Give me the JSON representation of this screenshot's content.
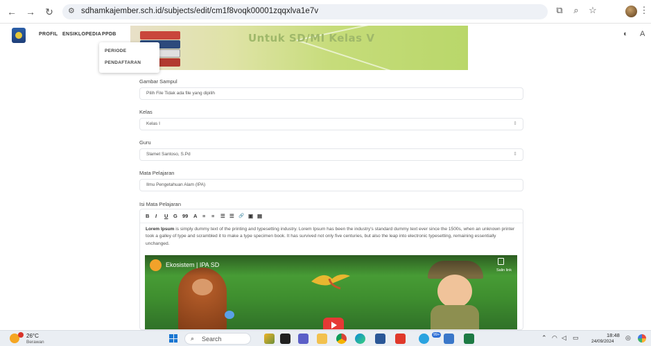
{
  "browser": {
    "url": "sdhamkajember.sch.id/subjects/edit/cm1f8voqk00001zqqxlva1e7v"
  },
  "site": {
    "menu": [
      "PROFIL",
      "ENSIKLOPEDIA",
      "PPDB"
    ],
    "dropdown": [
      "PERIODE",
      "PENDAFTARAN"
    ],
    "banner_text": "Untuk SD/MI Kelas V"
  },
  "form": {
    "gambar_label": "Gambar Sampul",
    "gambar_value": "Pilih File  Tidak ada file yang dipilih",
    "kelas_label": "Kelas",
    "kelas_value": "Kelas I",
    "guru_label": "Guru",
    "guru_value": "Slamet Santoso, S.Pd",
    "mapel_label": "Mata Pelajaran",
    "mapel_value": "Ilmu Pengetahuan Alam (IPA)",
    "isi_label": "Isi Mata Pelajaran"
  },
  "editor": {
    "toolbar": [
      "B",
      "I",
      "U",
      "G",
      "99",
      "A",
      "≡",
      "≡",
      "☰",
      "☰",
      "🔗",
      "▣",
      "▤"
    ],
    "bold_lead": "Lorem Ipsum",
    "body": " is simply dummy text of the printing and typesetting industry. Lorem Ipsum has been the industry's standard dummy text ever since the 1500s, when an unknown printer took a galley of type and scrambled it to make a type specimen book. It has survived not only five centuries, but also the leap into electronic typesetting, remaining essentially unchanged.",
    "video_title": "Ekosistem | IPA SD",
    "video_copy": "Salin link"
  },
  "taskbar": {
    "temp": "26°C",
    "weather": "Berawan",
    "search": "Search",
    "notif_badge": "99+",
    "time": "18:48",
    "date": "24/09/2024"
  },
  "colors": {
    "urlbar_bg": "#eef1f6",
    "banner_green": "#c6dc7a",
    "taskbar_bg": "#eaeef3",
    "youtube_red": "#e53935"
  }
}
